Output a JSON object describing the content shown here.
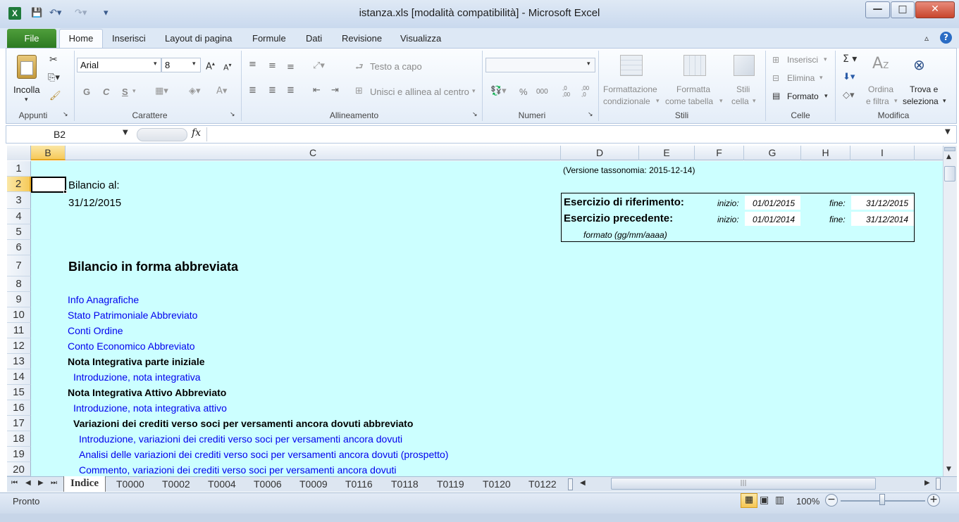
{
  "window": {
    "title": "istanza.xls  [modalità compatibilità]  -  Microsoft Excel",
    "controls": {
      "minimize": "—",
      "maximize": "□",
      "close": "✕"
    }
  },
  "qat": {
    "app_icon": "excel-icon",
    "save_icon": "save-icon",
    "undo_icon": "undo-icon",
    "redo_icon": "redo-icon"
  },
  "ribbon": {
    "tabs": [
      "File",
      "Home",
      "Inserisci",
      "Layout di pagina",
      "Formule",
      "Dati",
      "Revisione",
      "Visualizza"
    ],
    "active_tab": "Home",
    "groups": {
      "appunti": {
        "name": "Appunti",
        "paste": "Incolla"
      },
      "carattere": {
        "name": "Carattere",
        "font": "Arial",
        "size": "8",
        "bold": "G",
        "italic": "C",
        "underline": "S"
      },
      "allineamento": {
        "name": "Allineamento",
        "wrap": "Testo a capo",
        "merge": "Unisci e allinea al centro"
      },
      "numeri": {
        "name": "Numeri",
        "percent": "%",
        "thousands": "000",
        "inc_dec": ",0 ,00",
        "dec_dec": ",00 ,0"
      },
      "stili": {
        "name": "Stili",
        "cond1": "Formattazione",
        "cond2": "condizionale",
        "table1": "Formatta",
        "table2": "come tabella",
        "cell1": "Stili",
        "cell2": "cella"
      },
      "celle": {
        "name": "Celle",
        "insert": "Inserisci",
        "delete": "Elimina",
        "format": "Formato"
      },
      "modifica": {
        "name": "Modifica",
        "sort1": "Ordina",
        "sort2": "e filtra",
        "find1": "Trova e",
        "find2": "seleziona"
      }
    }
  },
  "formula_bar": {
    "name_box": "B2",
    "fx": "fx",
    "content": ""
  },
  "grid": {
    "columns": [
      "B",
      "C",
      "D",
      "E",
      "F",
      "G",
      "H",
      "I"
    ],
    "rows": [
      "1",
      "2",
      "3",
      "4",
      "5",
      "6",
      "7",
      "8",
      "9",
      "10",
      "11",
      "12",
      "13",
      "14",
      "15",
      "16",
      "17",
      "18",
      "19",
      "20"
    ],
    "cells": {
      "version": "(Versione tassonomia: 2015-12-14)",
      "bilancio_al": "Bilancio al:",
      "bilancio_date": "31/12/2015",
      "esercizio_rif": "Esercizio di riferimento:",
      "esercizio_prec": "Esercizio precedente:",
      "inizio": "inizio:",
      "fine": "fine:",
      "rif_inizio": "01/01/2015",
      "rif_fine": "31/12/2015",
      "prec_inizio": "01/01/2014",
      "prec_fine": "31/12/2014",
      "formato": "formato (gg/mm/aaaa)",
      "title": "Bilancio in forma abbreviata",
      "r9": "Info Anagrafiche",
      "r10": "Stato Patrimoniale Abbreviato",
      "r11": "Conti Ordine",
      "r12": "Conto Economico Abbreviato",
      "r13": "Nota  Integrativa parte iniziale",
      "r14": "Introduzione, nota integrativa",
      "r15": "Nota  Integrativa  Attivo  Abbreviato",
      "r16": "Introduzione, nota integrativa attivo",
      "r17": "Variazioni dei crediti verso soci per versamenti ancora dovuti abbreviato",
      "r18": "Introduzione, variazioni dei crediti verso soci per versamenti ancora dovuti",
      "r19": "Analisi delle variazioni dei crediti verso soci per versamenti ancora dovuti (prospetto)",
      "r20": "Commento, variazioni dei crediti verso soci per versamenti ancora dovuti"
    },
    "background_color": "#ccffff"
  },
  "sheets": [
    "Indice",
    "T0000",
    "T0002",
    "T0004",
    "T0006",
    "T0009",
    "T0116",
    "T0118",
    "T0119",
    "T0120",
    "T0122"
  ],
  "active_sheet": "Indice",
  "status": {
    "ready": "Pronto",
    "zoom": "100%"
  }
}
